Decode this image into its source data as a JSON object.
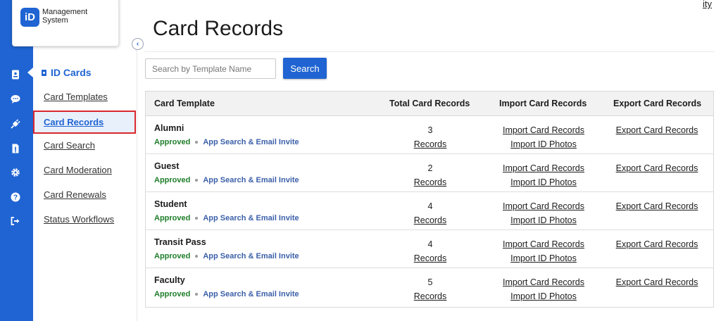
{
  "app": {
    "logo_letters": "iD",
    "logo_line1": "Management",
    "logo_line2": "System"
  },
  "rail_icons": [
    "id-card-icon",
    "chat-icon",
    "plug-icon",
    "document-icon",
    "gear-icon",
    "help-icon",
    "logout-icon"
  ],
  "top_link": "ity",
  "subnav": {
    "title": "ID Cards",
    "items": [
      "Card Templates",
      "Card Records",
      "Card Search",
      "Card Moderation",
      "Card Renewals",
      "Status Workflows"
    ],
    "active_index": 1
  },
  "page": {
    "title": "Card Records",
    "search_placeholder": "Search by Template Name",
    "search_button": "Search"
  },
  "table": {
    "headers": [
      "Card Template",
      "Total Card Records",
      "Import Card Records",
      "Export Card Records"
    ],
    "rows": [
      {
        "name": "Alumni",
        "status": "Approved",
        "workflow": "App Search & Email Invite",
        "count": "3",
        "records_link": "Records",
        "import_records": "Import Card Records",
        "import_photos": "Import ID Photos",
        "export": "Export Card Records"
      },
      {
        "name": "Guest",
        "status": "Approved",
        "workflow": "App Search & Email Invite",
        "count": "2",
        "records_link": "Records",
        "import_records": "Import Card Records",
        "import_photos": "Import ID Photos",
        "export": "Export Card Records"
      },
      {
        "name": "Student",
        "status": "Approved",
        "workflow": "App Search & Email Invite",
        "count": "4",
        "records_link": "Records",
        "import_records": "Import Card Records",
        "import_photos": "Import ID Photos",
        "export": "Export Card Records"
      },
      {
        "name": "Transit Pass",
        "status": "Approved",
        "workflow": "App Search & Email Invite",
        "count": "4",
        "records_link": "Records",
        "import_records": "Import Card Records",
        "import_photos": "Import ID Photos",
        "export": "Export Card Records"
      },
      {
        "name": "Faculty",
        "status": "Approved",
        "workflow": "App Search & Email Invite",
        "count": "5",
        "records_link": "Records",
        "import_records": "Import Card Records",
        "import_photos": "Import ID Photos",
        "export": "Export Card Records"
      }
    ]
  },
  "colors": {
    "brand": "#1f64d2",
    "approved": "#1e7d2a",
    "workflow": "#3b5fa8",
    "active_outline": "#d9272e"
  }
}
